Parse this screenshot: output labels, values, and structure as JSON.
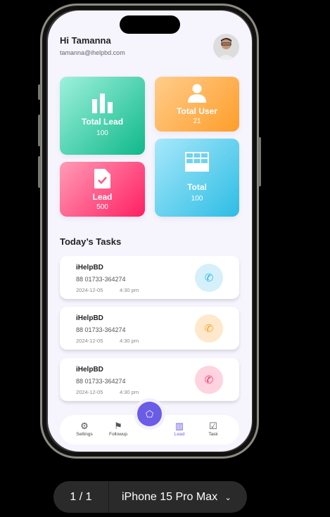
{
  "header": {
    "greeting": "Hi Tamanna",
    "email": "tamanna@ihelpbd.com"
  },
  "cards": [
    {
      "title": "Total Lead",
      "value": "100",
      "icon": "bar-chart-icon"
    },
    {
      "title": "Total User",
      "value": "21",
      "icon": "user-icon"
    },
    {
      "title": "Lead",
      "value": "500",
      "icon": "document-check-icon"
    },
    {
      "title": "Total",
      "value": "100",
      "icon": "table-icon"
    }
  ],
  "tasks_title": "Today’s Tasks",
  "tasks": [
    {
      "name": "iHelpBD",
      "phone": "88 01733-364274",
      "date": "2024-12-05",
      "time": "4:30 pm",
      "color": "#29b6e6"
    },
    {
      "name": "iHelpBD",
      "phone": "88 01733-364274",
      "date": "2024-12-05",
      "time": "4:30 pm",
      "color": "#ff9f1a"
    },
    {
      "name": "iHelpBD",
      "phone": "88 01733-364274",
      "date": "2024-12-05",
      "time": "4:30 pm",
      "color": "#ff2f6d"
    }
  ],
  "nav": {
    "settings": "Settings",
    "followup": "Followup",
    "lead": "Lead",
    "task": "Task"
  },
  "pager": {
    "page": "1 / 1",
    "device": "iPhone 15 Pro Max"
  }
}
